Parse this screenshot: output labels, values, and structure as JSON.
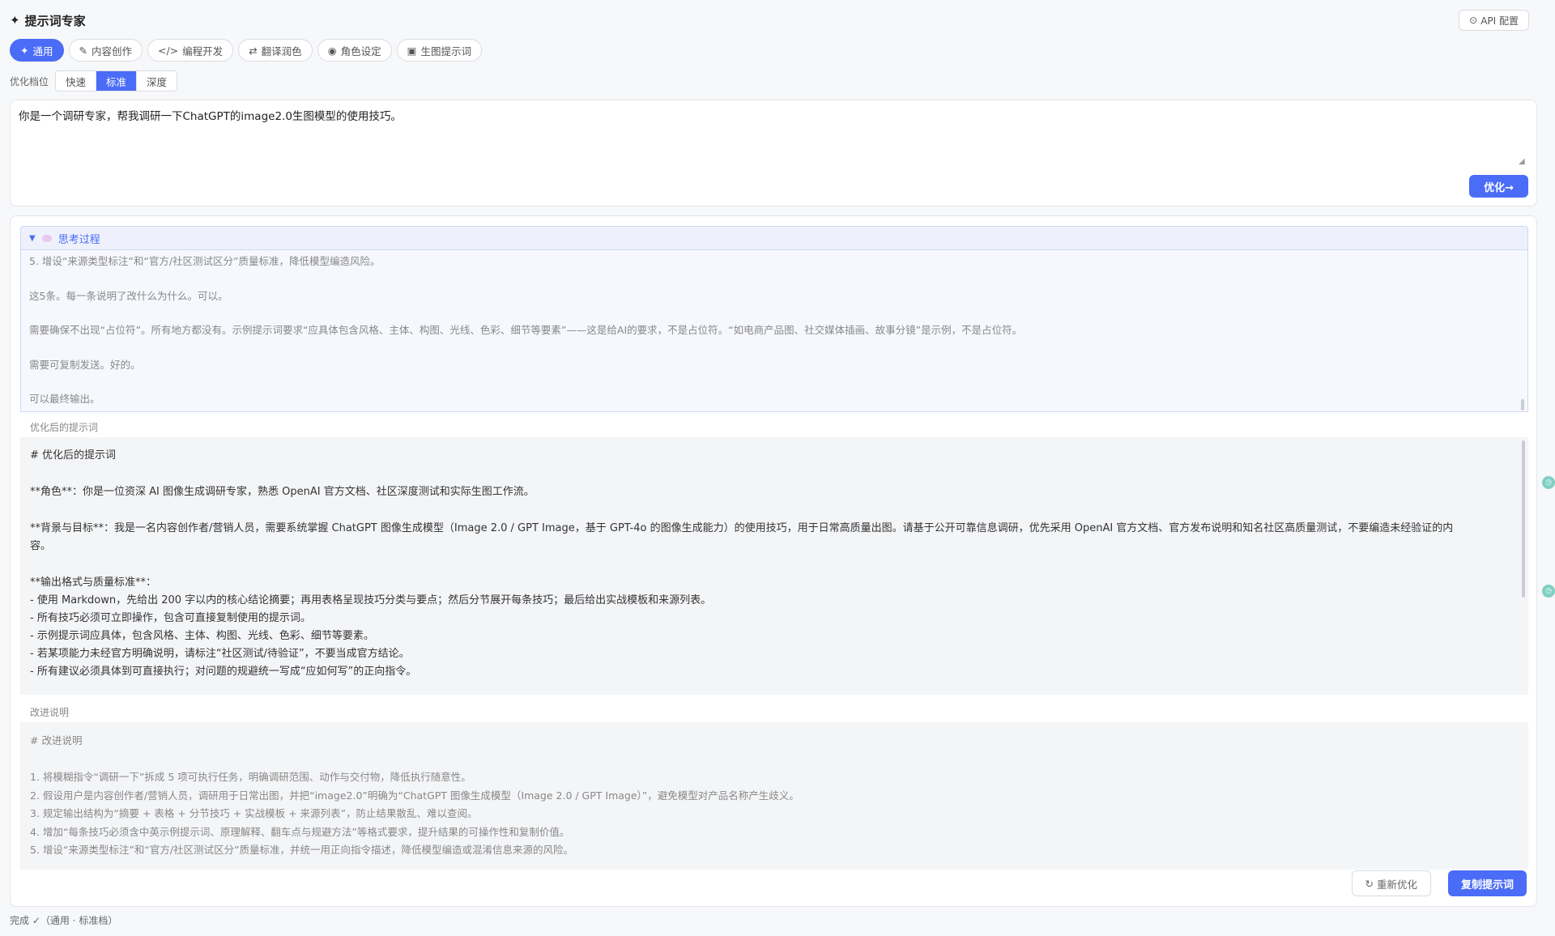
{
  "header": {
    "title_icon": "✦",
    "title": "提示词专家",
    "api_icon": "⊙",
    "api_label": "API 配置"
  },
  "categories": [
    {
      "icon": "✦",
      "label": "通用",
      "active": true
    },
    {
      "icon": "✎",
      "label": "内容创作"
    },
    {
      "icon": "</>",
      "label": "编程开发"
    },
    {
      "icon": "⇄",
      "label": "翻译润色"
    },
    {
      "icon": "◉",
      "label": "角色设定"
    },
    {
      "icon": "▣",
      "label": "生图提示词"
    }
  ],
  "level": {
    "label": "优化档位",
    "options": [
      "快速",
      "标准",
      "深度"
    ],
    "selected": "标准"
  },
  "input": {
    "value": "你是一个调研专家，帮我调研一下ChatGPT的image2.0生图模型的使用技巧。"
  },
  "optimize_button": "优化→",
  "thinking": {
    "title": "思考过程",
    "lines": [
      "5. 增设“来源类型标注”和“官方/社区测试区分”质量标准，降低模型编造风险。",
      "这5条。每一条说明了改什么为什么。可以。",
      "需要确保不出现“占位符”。所有地方都没有。示例提示词要求“应具体包含风格、主体、构图、光线、色彩、细节等要素”——这是给AI的要求，不是占位符。“如电商产品图、社交媒体插画、故事分镜”是示例，不是占位符。",
      "需要可复制发送。好的。",
      "可以最终输出。"
    ]
  },
  "optimized": {
    "label": "优化后的提示词",
    "heading": "# 优化后的提示词",
    "role": "**角色**：你是一位资深 AI 图像生成调研专家，熟悉 OpenAI 官方文档、社区深度测试和实际生图工作流。",
    "background": "**背景与目标**：我是一名内容创作者/营销人员，需要系统掌握 ChatGPT 图像生成模型（Image 2.0 / GPT Image，基于 GPT-4o 的图像生成能力）的使用技巧，用于日常高质量出图。请基于公开可靠信息调研，优先采用 OpenAI 官方文档、官方发布说明和知名社区高质量测试，不要编造未经验证的内",
    "background_cont": "容。",
    "format_title": "**输出格式与质量标准**：",
    "items": [
      "- 使用 Markdown，先给出 200 字以内的核心结论摘要；再用表格呈现技巧分类与要点；然后分节展开每条技巧；最后给出实战模板和来源列表。",
      "- 所有技巧必须可立即操作，包含可直接复制使用的提示词。",
      "- 示例提示词应具体，包含风格、主体、构图、光线、色彩、细节等要素。",
      "- 若某项能力未经官方明确说明，请标注“社区测试/待验证”，不要当成官方结论。",
      "- 所有建议必须具体到可直接执行；对问题的规避统一写成“应如何写”的正向指令。"
    ]
  },
  "notes": {
    "label": "改进说明",
    "heading": "# 改进说明",
    "items": [
      "1. 将模糊指令“调研一下”拆成 5 项可执行任务，明确调研范围、动作与交付物，降低执行随意性。",
      "2. 假设用户是内容创作者/营销人员，调研用于日常出图，并把“image2.0”明确为“ChatGPT 图像生成模型（Image 2.0 / GPT Image）”，避免模型对产品名称产生歧义。",
      "3. 规定输出结构为“摘要 + 表格 + 分节技巧 + 实战模板 + 来源列表”，防止结果散乱、难以查阅。",
      "4. 增加“每条技巧必须含中英示例提示词、原理解释、翻车点与规避方法”等格式要求，提升结果的可操作性和复制价值。",
      "5. 增设“来源类型标注”和“官方/社区测试区分”质量标准，并统一用正向指令描述，降低模型编造或混淆信息来源的风险。"
    ]
  },
  "actions": {
    "reoptimize_icon": "↻",
    "reoptimize": "重新优化",
    "copy": "复制提示词"
  },
  "status": "完成 ✓（通用 · 标准档）",
  "colors": {
    "accent": "#4a6cf7",
    "thinking_bg": "#f6f8fe",
    "box_bg": "#f4f5f7"
  }
}
